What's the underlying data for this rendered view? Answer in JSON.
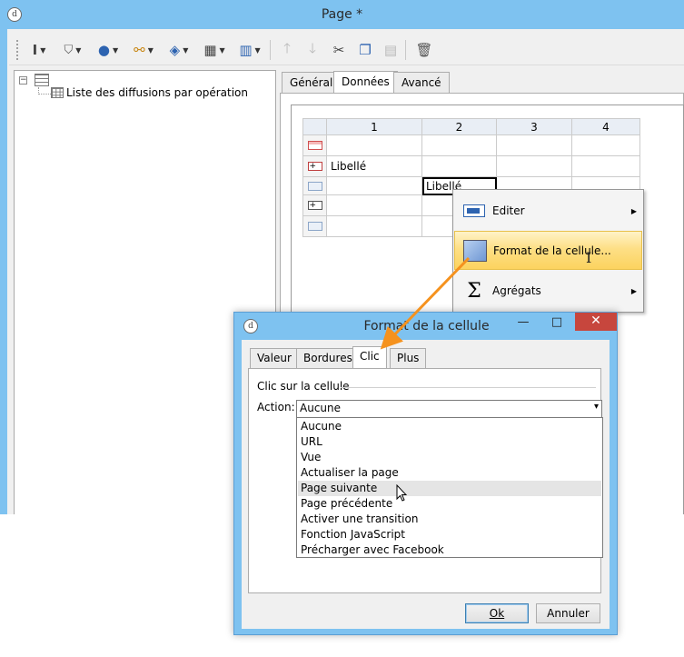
{
  "main_window": {
    "title": "Page *",
    "app_icon": "d"
  },
  "toolbar": {
    "buttons": [
      "insert-field-icon",
      "filter-icon",
      "globe-icon",
      "link-icon",
      "layers-icon",
      "table-icon",
      "columns-icon",
      "move-up-icon",
      "move-down-icon",
      "cut-icon",
      "copy-icon",
      "paste-icon",
      "delete-icon"
    ]
  },
  "tree": {
    "root_toggle": "−",
    "items": [
      {
        "label": "Liste des diffusions par opération"
      }
    ]
  },
  "main_tabs": [
    "Général",
    "Données",
    "Avancé"
  ],
  "active_main_tab": "Données",
  "grid": {
    "columns": [
      "1",
      "2",
      "3",
      "4"
    ],
    "rows": [
      {
        "cells": [
          "",
          "",
          "",
          ""
        ]
      },
      {
        "cells": [
          "Libellé",
          "",
          "",
          ""
        ]
      },
      {
        "cells": [
          "",
          "Libellé",
          "",
          ""
        ]
      },
      {
        "cells": [
          "",
          "",
          "",
          ""
        ]
      },
      {
        "cells": [
          "",
          "",
          "",
          ""
        ]
      }
    ]
  },
  "context_menu": {
    "items": [
      {
        "label": "Editer",
        "icon": "edit-icon",
        "submenu": true
      },
      {
        "label": "Format de la cellule...",
        "icon": "format-cell-icon",
        "submenu": false
      },
      {
        "label": "Agrégats",
        "icon": "sigma-icon",
        "submenu": true
      }
    ]
  },
  "dialog": {
    "title": "Format de la cellule",
    "app_icon": "d",
    "minimize": "—",
    "maximize": "□",
    "close": "✕",
    "tabs": [
      "Valeur",
      "Bordures",
      "Clic",
      "Plus"
    ],
    "active_tab": "Clic",
    "section_label": "Clic sur la cellule",
    "action_label": "Action:",
    "action_value": "Aucune",
    "options": [
      "Aucune",
      "URL",
      "Vue",
      "Actualiser la page",
      "Page suivante",
      "Page précédente",
      "Activer une transition",
      "Fonction JavaScript",
      "Précharger avec Facebook"
    ],
    "hovered_option": "Page suivante",
    "ok_label": "Ok",
    "cancel_label": "Annuler"
  },
  "colors": {
    "title_bar": "#7ec2f0",
    "menu_highlight": "#fcd35f",
    "arrow": "#f5921e",
    "close_button": "#c7463d"
  }
}
